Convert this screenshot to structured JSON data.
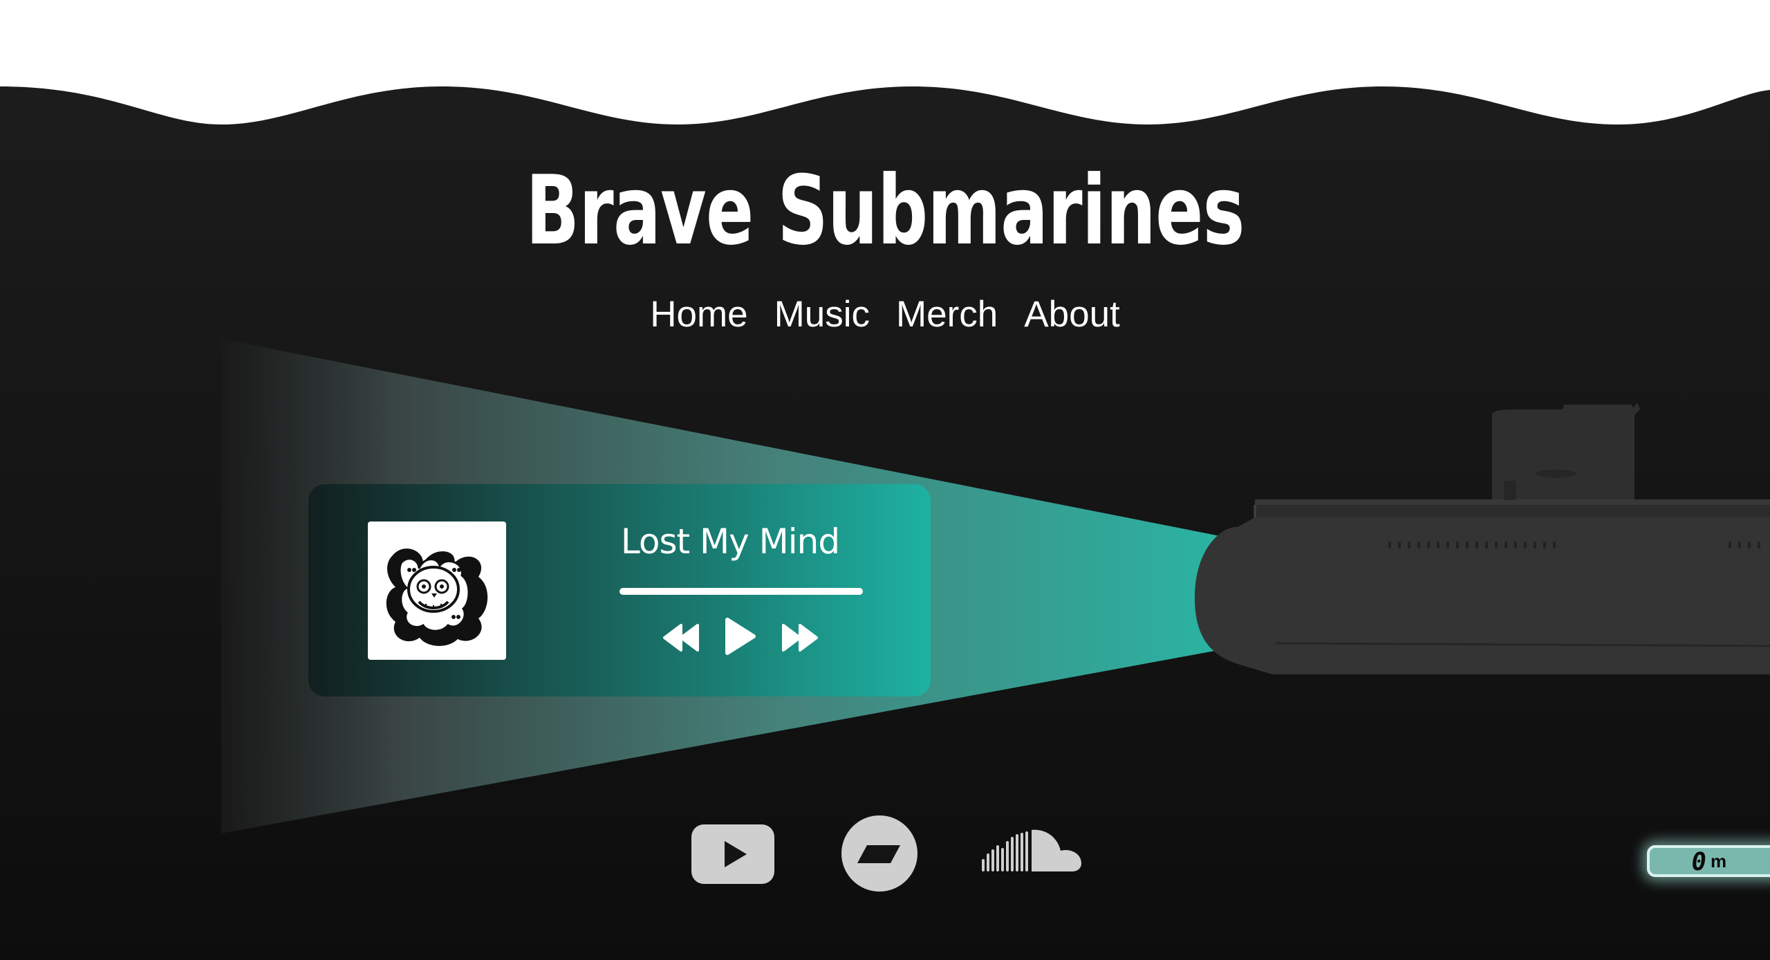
{
  "site": {
    "title": "Brave Submarines"
  },
  "nav": {
    "items": [
      {
        "label": "Home"
      },
      {
        "label": "Music"
      },
      {
        "label": "Merch"
      },
      {
        "label": "About"
      }
    ]
  },
  "player": {
    "track_title": "Lost My Mind",
    "progress": 1.0,
    "controls": {
      "rewind_icon": "rewind-icon",
      "play_icon": "play-icon",
      "fast_forward_icon": "fast-forward-icon"
    },
    "album_art_icon": "skull-cartoon-icon"
  },
  "social": {
    "icons": [
      "youtube-icon",
      "bandcamp-icon",
      "soundcloud-icon"
    ]
  },
  "depth_gauge": {
    "value": "0",
    "unit": "m"
  },
  "colors": {
    "background": "#141414",
    "water_surface": "#ffffff",
    "accent": "#1eb2a3",
    "submarine": "#3a3a3a",
    "icon_gray": "#cfcfcf"
  }
}
